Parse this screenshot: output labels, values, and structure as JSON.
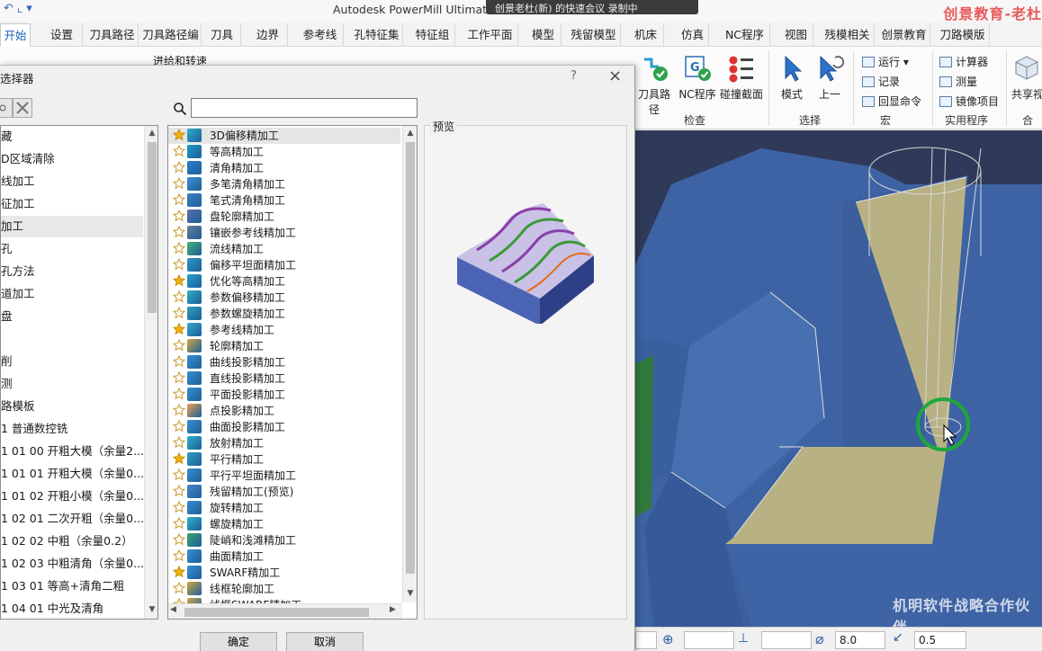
{
  "app": {
    "title": "Autodesk PowerMill Ultimate 2023",
    "overlay_text": "创景老杜(新) 的快速会议   录制中",
    "brand": "创景教育-老杜"
  },
  "tabs": [
    {
      "label": "开始",
      "active": true
    },
    {
      "label": "设置"
    },
    {
      "label": "刀具路径"
    },
    {
      "label": "刀具路径编"
    },
    {
      "label": "刀具"
    },
    {
      "label": "边界"
    },
    {
      "label": "参考线"
    },
    {
      "label": "孔特征集"
    },
    {
      "label": "特征组"
    },
    {
      "label": "工作平面"
    },
    {
      "label": "模型"
    },
    {
      "label": "残留模型"
    },
    {
      "label": "机床"
    },
    {
      "label": "仿真"
    },
    {
      "label": "NC程序"
    },
    {
      "label": "视图"
    },
    {
      "label": "残模相关"
    },
    {
      "label": "创景教育"
    },
    {
      "label": "刀路模版"
    }
  ],
  "ribbon": {
    "partial_text": "进给和转速",
    "check_buttons": [
      "刀具路径",
      "NC程序",
      "碰撞截面"
    ],
    "check_group": "检查",
    "select_buttons": [
      "模式",
      "上一"
    ],
    "select_group": "选择",
    "macro_items": [
      "运行",
      "记录",
      "回显命令"
    ],
    "macro_group": "宏",
    "util_items": [
      "计算器",
      "测量",
      "镜像项目"
    ],
    "util_group": "实用程序",
    "share_button": "共享视",
    "collab_group": "合作"
  },
  "dialog": {
    "title": "选择器",
    "help": "?",
    "close": "×",
    "search_placeholder": "",
    "preview_label": "预览",
    "ok": "确定",
    "cancel": "取消",
    "categories": [
      "藏",
      "D区域清除",
      "线加工",
      "征加工",
      "加工",
      "孔",
      "孔方法",
      "道加工",
      "盘",
      "",
      "削",
      "测",
      "路模板",
      "1 普通数控铣",
      "1 01 00 开粗大模（余量2...",
      "1 01 01 开粗大模（余量0...",
      "1 01 02 开粗小模（余量0...",
      "1 02 01 二次开粗（余量0...",
      "1 02 02 中粗（余量0.2）",
      "1 02 03 中粗清角（余量0...",
      "1 03 01 等高+清角二粗",
      "1 04 01 中光及清角"
    ],
    "selected_category_index": 4,
    "strategies": [
      {
        "label": "3D偏移精加工",
        "fav": true,
        "color": "#2fb0c6"
      },
      {
        "label": "等高精加工",
        "fav": false,
        "color": "#1f9bc4"
      },
      {
        "label": "清角精加工",
        "fav": false,
        "color": "#2b7fc9"
      },
      {
        "label": "多笔清角精加工",
        "fav": false,
        "color": "#3f8fd0"
      },
      {
        "label": "笔式清角精加工",
        "fav": false,
        "color": "#3d7fc0"
      },
      {
        "label": "盘轮廓精加工",
        "fav": false,
        "color": "#5a6ea8"
      },
      {
        "label": "镶嵌参考线精加工",
        "fav": false,
        "color": "#6c7c95"
      },
      {
        "label": "流线精加工",
        "fav": false,
        "color": "#47b46e"
      },
      {
        "label": "偏移平坦面精加工",
        "fav": false,
        "color": "#2d97c3"
      },
      {
        "label": "优化等高精加工",
        "fav": true,
        "color": "#27a0c8"
      },
      {
        "label": "参数偏移精加工",
        "fav": false,
        "color": "#2fb0c6"
      },
      {
        "label": "参数螺旋精加工",
        "fav": false,
        "color": "#2e9fbf"
      },
      {
        "label": "参考线精加工",
        "fav": true,
        "color": "#3aa6c9"
      },
      {
        "label": "轮廓精加工",
        "fav": false,
        "color": "#d4a640"
      },
      {
        "label": "曲线投影精加工",
        "fav": false,
        "color": "#3a8ed0"
      },
      {
        "label": "直线投影精加工",
        "fav": false,
        "color": "#3a8ed0"
      },
      {
        "label": "平面投影精加工",
        "fav": false,
        "color": "#3a8ed0"
      },
      {
        "label": "点投影精加工",
        "fav": false,
        "color": "#e8a04a"
      },
      {
        "label": "曲面投影精加工",
        "fav": false,
        "color": "#3a8ed0"
      },
      {
        "label": "放射精加工",
        "fav": false,
        "color": "#2fb0c6"
      },
      {
        "label": "平行精加工",
        "fav": true,
        "color": "#2e9fbf"
      },
      {
        "label": "平行平坦面精加工",
        "fav": false,
        "color": "#3a8ed0"
      },
      {
        "label": "残留精加工(预览)",
        "fav": false,
        "color": "#4b86c7"
      },
      {
        "label": "旋转精加工",
        "fav": false,
        "color": "#3a8ed0"
      },
      {
        "label": "螺旋精加工",
        "fav": false,
        "color": "#2fb0c6"
      },
      {
        "label": "陡峭和浅滩精加工",
        "fav": false,
        "color": "#3aa36b"
      },
      {
        "label": "曲面精加工",
        "fav": false,
        "color": "#3a8ed0"
      },
      {
        "label": "SWARF精加工",
        "fav": true,
        "color": "#3a8ed0"
      },
      {
        "label": "线框轮廓加工",
        "fav": false,
        "color": "#d4a640"
      },
      {
        "label": "线框SWARF精加工",
        "fav": false,
        "color": "#d4a640"
      }
    ],
    "selected_strategy_index": 0
  },
  "status": {
    "tolerance": "8.0",
    "stepover": "0.5"
  },
  "viewport_watermark": "机明软件战略合作伙伴"
}
